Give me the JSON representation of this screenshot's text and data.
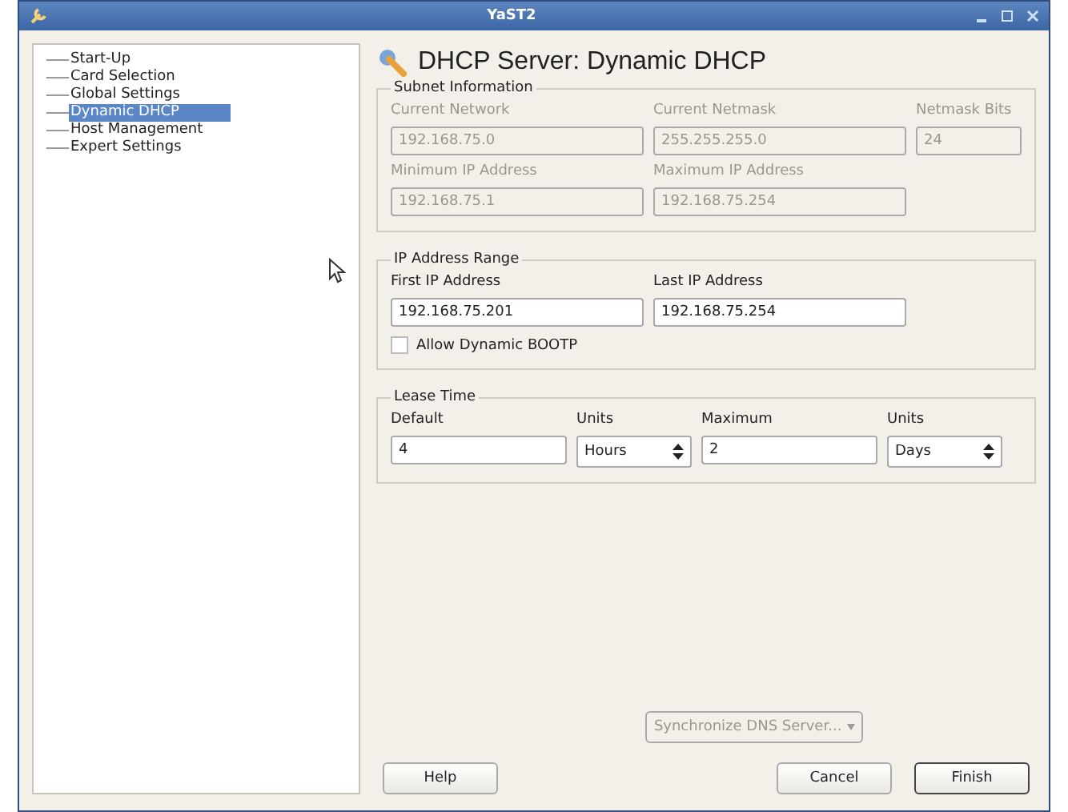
{
  "window": {
    "title": "YaST2"
  },
  "tree": [
    {
      "label": "Start-Up",
      "selected": false
    },
    {
      "label": "Card Selection",
      "selected": false
    },
    {
      "label": "Global Settings",
      "selected": false
    },
    {
      "label": "Dynamic DHCP",
      "selected": true
    },
    {
      "label": "Host Management",
      "selected": false
    },
    {
      "label": "Expert Settings",
      "selected": false
    }
  ],
  "heading": "DHCP Server: Dynamic DHCP",
  "groups": [
    {
      "title": "Subnet Information",
      "disabled": true,
      "rows": [
        [
          {
            "kind": "text",
            "label": "Current Network",
            "value": "192.168.75.0"
          },
          {
            "kind": "text",
            "label": "Current Netmask",
            "value": "255.255.255.0"
          },
          {
            "kind": "text",
            "label": "Netmask Bits",
            "value": "24"
          }
        ],
        [
          {
            "kind": "text",
            "label": "Minimum IP Address",
            "value": "192.168.75.1"
          },
          {
            "kind": "text",
            "label": "Maximum IP Address",
            "value": "192.168.75.254"
          }
        ]
      ]
    },
    {
      "title": "IP Address Range",
      "disabled": false,
      "rows": [
        [
          {
            "kind": "text",
            "label": "First IP Address",
            "value": "192.168.75.201"
          },
          {
            "kind": "text",
            "label": "Last IP Address",
            "value": "192.168.75.254"
          }
        ],
        [
          {
            "kind": "checkbox",
            "label": "Allow Dynamic BOOTP",
            "checked": false
          }
        ]
      ]
    },
    {
      "title": "Lease Time",
      "disabled": false,
      "rows": [
        [
          {
            "kind": "text",
            "label": "Default",
            "value": "4"
          },
          {
            "kind": "select",
            "label": "Units",
            "value": "Hours"
          },
          {
            "kind": "text",
            "label": "Maximum",
            "value": "2"
          },
          {
            "kind": "select",
            "label": "Units",
            "value": "Days"
          }
        ]
      ]
    }
  ],
  "sync_button": {
    "label": "Synchronize DNS Server...",
    "disabled": true
  },
  "buttons": [
    {
      "label": "Help",
      "default": false
    },
    {
      "label": "Cancel",
      "default": false
    },
    {
      "label": "Finish",
      "default": true
    }
  ]
}
